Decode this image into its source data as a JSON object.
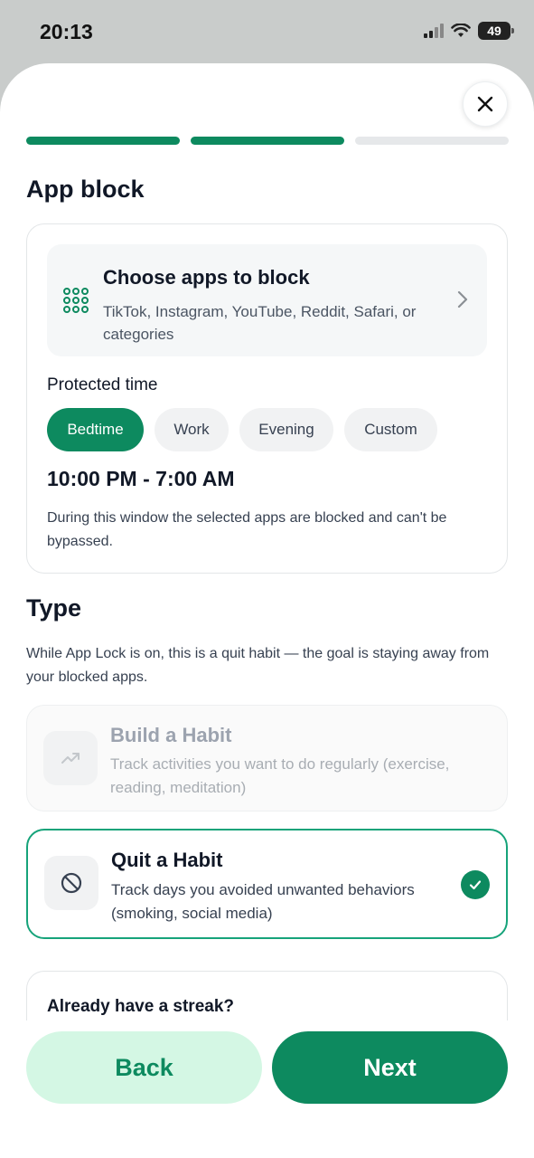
{
  "status_bar": {
    "time": "20:13",
    "battery": "49"
  },
  "progress": {
    "total_steps": 3,
    "completed_steps": 2
  },
  "app_block": {
    "title": "App block",
    "choose": {
      "title": "Choose apps to block",
      "subtitle": "TikTok, Instagram, YouTube, Reddit, Safari, or categories"
    },
    "protected_time_label": "Protected time",
    "chips": [
      "Bedtime",
      "Work",
      "Evening",
      "Custom"
    ],
    "active_chip": "Bedtime",
    "time_range": "10:00 PM - 7:00 AM",
    "description": "During this window the selected apps are blocked and can't be bypassed."
  },
  "type": {
    "title": "Type",
    "description": "While App Lock is on, this is a quit habit — the goal is staying away from your blocked apps.",
    "options": [
      {
        "title": "Build a Habit",
        "subtitle": "Track activities you want to do regularly (exercise, reading, meditation)",
        "state": "disabled"
      },
      {
        "title": "Quit a Habit",
        "subtitle": "Track days you avoided unwanted behaviors (smoking, social media)",
        "state": "selected"
      }
    ]
  },
  "streak": {
    "title": "Already have a streak?"
  },
  "buttons": {
    "back": "Back",
    "next": "Next"
  },
  "colors": {
    "accent": "#0d8a5f",
    "accent_light": "#d4f7e4",
    "selected_border": "#16a37a"
  }
}
